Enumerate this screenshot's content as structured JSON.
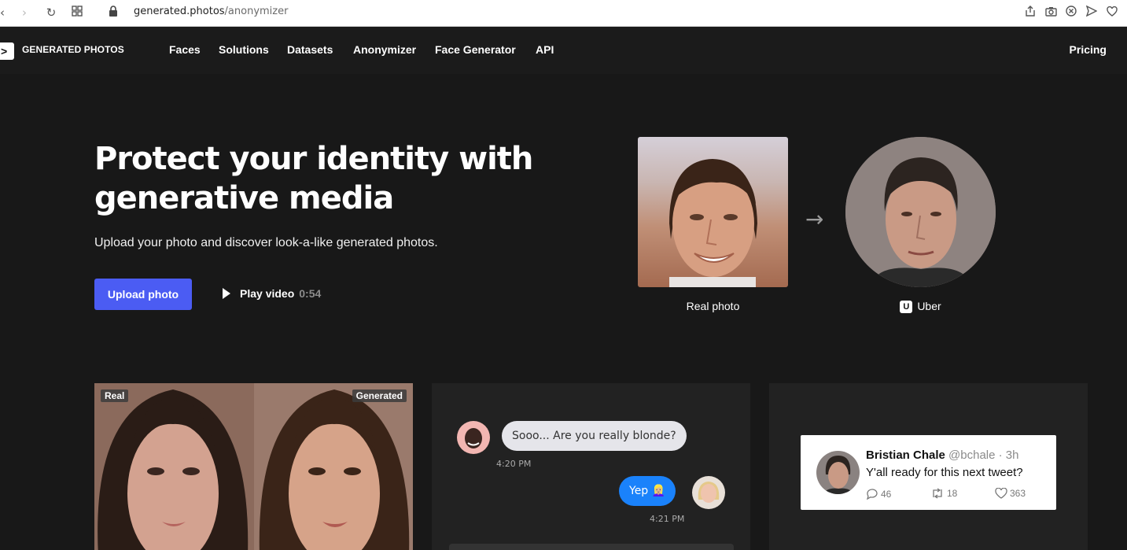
{
  "browser": {
    "url_domain": "generated.photos",
    "url_path": "/anonymizer"
  },
  "nav": {
    "logo_text": "GENERATED PHOTOS",
    "links": [
      "Faces",
      "Solutions",
      "Datasets",
      "Anonymizer",
      "Face Generator",
      "API"
    ],
    "pricing": "Pricing"
  },
  "hero": {
    "title": "Protect your identity with generative media",
    "subtitle": "Upload your photo and discover look-a-like generated photos.",
    "upload_label": "Upload photo",
    "play_label": "Play video",
    "play_duration": "0:54",
    "real_caption": "Real photo",
    "generated_caption": "Uber",
    "generated_badge": "U"
  },
  "cards": {
    "real_tag": "Real",
    "generated_tag": "Generated",
    "chat": {
      "incoming_text": "Sooo... Are you really blonde?",
      "incoming_time": "4:20 PM",
      "outgoing_text": "Yep 👱🏼‍♀️",
      "outgoing_time": "4:21 PM"
    },
    "tweet": {
      "name": "Bristian Chale",
      "handle": "@bchale · 3h",
      "text": "Y'all ready for this next tweet?",
      "replies": "46",
      "retweets": "18",
      "likes": "363"
    }
  },
  "colors": {
    "accent": "#4b5cf3",
    "background": "#181818",
    "chat_blue": "#1a82fb"
  }
}
